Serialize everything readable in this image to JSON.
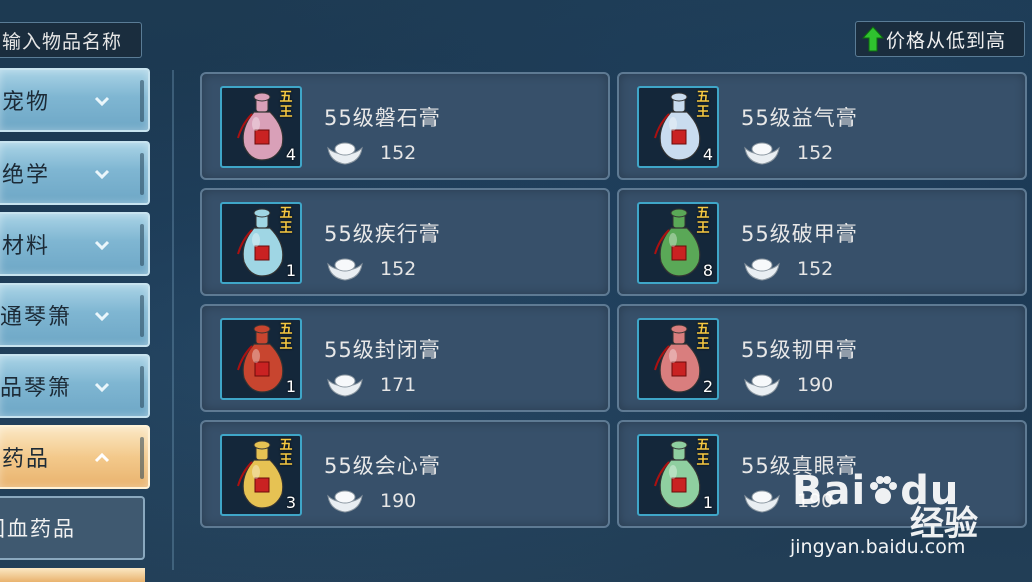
{
  "search": {
    "placeholder": "输入物品名称"
  },
  "sort": {
    "label": "价格从低到高",
    "arrow_icon": "green-up-arrow-icon",
    "arrow_color": "#2fc22f"
  },
  "sidebar": {
    "items": [
      {
        "label": "宠物"
      },
      {
        "label": "绝学"
      },
      {
        "label": "材料"
      },
      {
        "label": "普通琴箫"
      },
      {
        "label": "极品琴箫"
      },
      {
        "label": "药品",
        "active": true
      }
    ],
    "sub_items": [
      {
        "label": "回血药品"
      }
    ],
    "active_color": "#f3c98b",
    "item_color": "#7fb6d2"
  },
  "items": [
    {
      "name": "55级磐石膏",
      "price": "152",
      "qty": "4",
      "badge": "五王",
      "vial_color": "#d9a0b8"
    },
    {
      "name": "55级益气膏",
      "price": "152",
      "qty": "4",
      "badge": "五王",
      "vial_color": "#c9dcef"
    },
    {
      "name": "55级疾行膏",
      "price": "152",
      "qty": "1",
      "badge": "五王",
      "vial_color": "#9fd6e4"
    },
    {
      "name": "55级破甲膏",
      "price": "152",
      "qty": "8",
      "badge": "五王",
      "vial_color": "#5aa857"
    },
    {
      "name": "55级封闭膏",
      "price": "171",
      "qty": "1",
      "badge": "五王",
      "vial_color": "#c8452f"
    },
    {
      "name": "55级韧甲膏",
      "price": "190",
      "qty": "2",
      "badge": "五王",
      "vial_color": "#d97e7e"
    },
    {
      "name": "55级会心膏",
      "price": "190",
      "qty": "3",
      "badge": "五王",
      "vial_color": "#e6c253"
    },
    {
      "name": "55级真眼膏",
      "price": "190",
      "qty": "1",
      "badge": "五王",
      "vial_color": "#8fcfa0"
    }
  ],
  "currency_icon": "silver-ingot-icon",
  "watermark": {
    "logo": "Bai",
    "logo_tail": "du",
    "brand_cn": "经验",
    "url": "jingyan.baidu.com"
  }
}
